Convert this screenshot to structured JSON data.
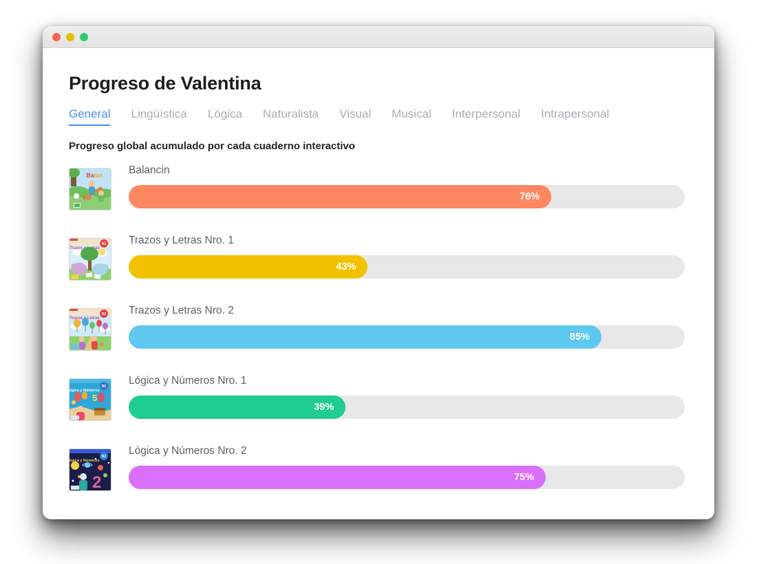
{
  "window": {
    "traffic_lights": [
      "close",
      "minimize",
      "maximize"
    ],
    "colors": {
      "close": "#fc6058",
      "minimize": "#e8c000",
      "maximize": "#2acd69"
    }
  },
  "header": {
    "title": "Progreso de Valentina"
  },
  "tabs": [
    {
      "label": "General",
      "active": true
    },
    {
      "label": "Lingüística",
      "active": false
    },
    {
      "label": "Lógica",
      "active": false
    },
    {
      "label": "Naturalista",
      "active": false
    },
    {
      "label": "Visual",
      "active": false
    },
    {
      "label": "Musical",
      "active": false
    },
    {
      "label": "Interpersonal",
      "active": false
    },
    {
      "label": "Intrapersonal",
      "active": false
    }
  ],
  "main": {
    "subtitle": "Progreso global acumulado por cada cuaderno interactivo"
  },
  "chart_data": {
    "type": "bar",
    "title": "Progreso global acumulado por cada cuaderno interactivo",
    "orientation": "horizontal",
    "xlabel": "",
    "ylabel": "",
    "xlim": [
      0,
      100
    ],
    "unit": "%",
    "grid": false,
    "legend": "none",
    "categories": [
      "Balancin",
      "Trazos y Letras Nro. 1",
      "Trazos y Letras Nro. 2",
      "Lógica y Números Nro. 1",
      "Lógica y Números Nro. 2"
    ],
    "values": [
      76,
      43,
      85,
      39,
      75
    ],
    "value_labels": [
      "76%",
      "43%",
      "85%",
      "39%",
      "75%"
    ],
    "colors": [
      "#fc8761",
      "#f2c200",
      "#5ec8f0",
      "#1fcc92",
      "#d96ffa"
    ],
    "track_color": "#e8e8e8"
  },
  "rows": [
    {
      "title": "Balancin",
      "percent": 76,
      "percent_label": "76%",
      "color": "#fc8761",
      "thumb_name": "cover-balancin"
    },
    {
      "title": "Trazos y Letras Nro. 1",
      "percent": 43,
      "percent_label": "43%",
      "color": "#f2c200",
      "thumb_name": "cover-trazos-1"
    },
    {
      "title": "Trazos y Letras Nro. 2",
      "percent": 85,
      "percent_label": "85%",
      "color": "#5ec8f0",
      "thumb_name": "cover-trazos-2"
    },
    {
      "title": "Lógica y Números Nro. 1",
      "percent": 39,
      "percent_label": "39%",
      "color": "#1fcc92",
      "thumb_name": "cover-logica-1"
    },
    {
      "title": "Lógica y Números Nro. 2",
      "percent": 75,
      "percent_label": "75%",
      "color": "#d96ffa",
      "thumb_name": "cover-logica-2"
    }
  ],
  "theme": {
    "accent": "#4a8df4",
    "title_color": "#1c1c21",
    "tab_inactive": "#a9adb4",
    "row_title": "#5b5f66"
  }
}
